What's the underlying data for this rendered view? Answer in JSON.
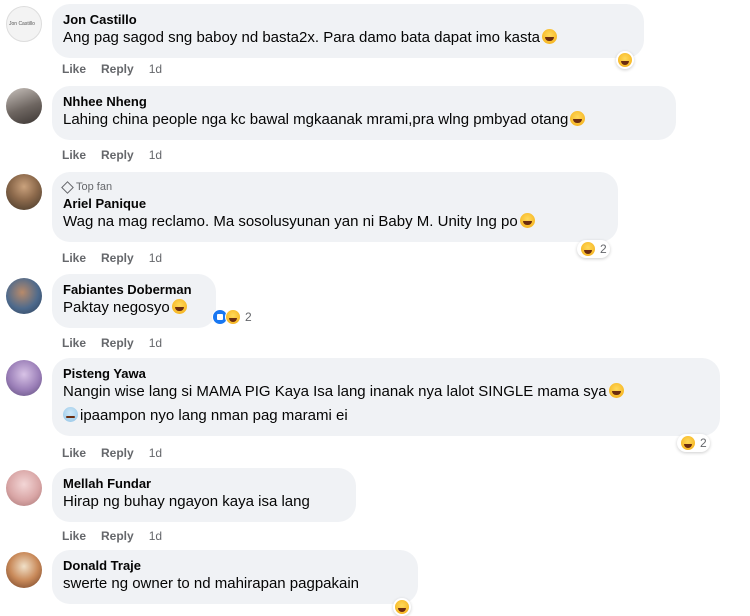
{
  "actions": {
    "like": "Like",
    "reply": "Reply"
  },
  "comments": [
    {
      "author": "Jon Castillo",
      "avatar_text": "Jon Castillo",
      "text": "Ang pag sagod sng baboy nd basta2x. Para damo bata dapat imo kasta",
      "time": "1d",
      "reaction_count": ""
    },
    {
      "author": "Nhhee Nheng",
      "text": "Lahing china people nga kc bawal mgkaanak mrami,pra wlng pmbyad otang",
      "time": "1d",
      "reaction_count": ""
    },
    {
      "author": "Ariel Panique",
      "badge": "Top fan",
      "text": "Wag na mag reclamo. Ma sosolusyunan yan ni Baby M. Unity Ing po",
      "time": "1d",
      "reaction_count": "2"
    },
    {
      "author": "Fabiantes Doberman",
      "text": "Paktay negosyo",
      "time": "1d",
      "reaction_count": "2"
    },
    {
      "author": "Pisteng Yawa",
      "text": "Nangin wise lang si MAMA PIG Kaya Isa lang inanak nya lalot SINGLE mama sya",
      "text2": "ipaampon nyo lang nman pag marami ei",
      "time": "1d",
      "reaction_count": "2"
    },
    {
      "author": "Mellah Fundar",
      "text": "Hirap ng buhay ngayon kaya isa lang",
      "time": "1d",
      "reaction_count": ""
    },
    {
      "author": "Donald Traje",
      "text": "swerte ng owner to nd mahirapan pagpakain",
      "time": "",
      "reaction_count": ""
    }
  ]
}
